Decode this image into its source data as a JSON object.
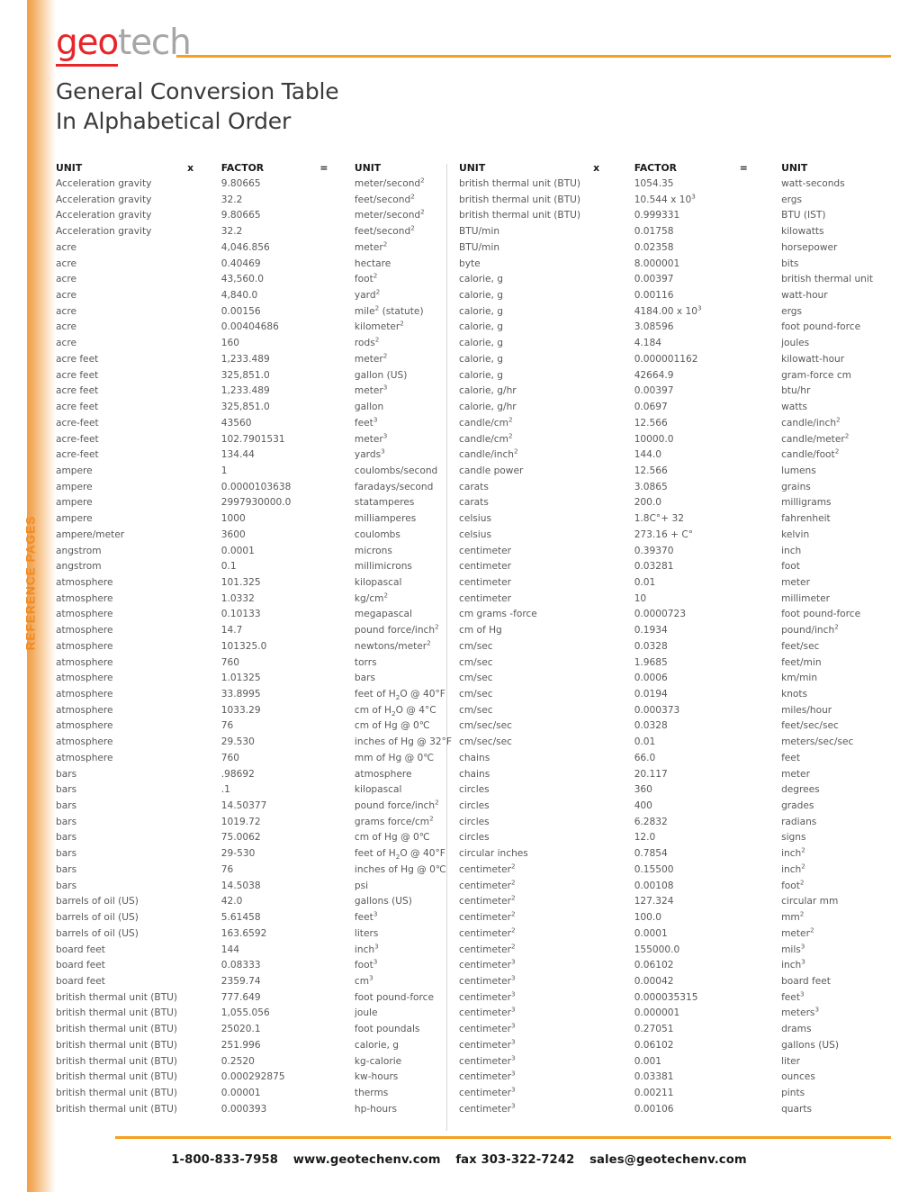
{
  "brand": {
    "logo_part1": "geo",
    "logo_part2": "tech",
    "side_tab_label": "REFERENCE PAGES",
    "accent_orange": "#f5a01f",
    "logo_red": "#e8262a",
    "logo_gray": "#a6a6a6"
  },
  "header": {
    "title_line1": "General Conversion Table",
    "title_line2": "In Alphabetical Order"
  },
  "table": {
    "headers": {
      "unit": "UNIT",
      "times": "x",
      "factor": "FACTOR",
      "equals": "=",
      "result": "UNIT"
    },
    "left_rows": [
      {
        "unit": "Acceleration gravity",
        "factor": "9.80665",
        "result": "meter/second",
        "result_sup": "2"
      },
      {
        "unit": "Acceleration gravity",
        "factor": "32.2",
        "result": "feet/second",
        "result_sup": "2"
      },
      {
        "unit": "Acceleration gravity",
        "factor": "9.80665",
        "result": "meter/second",
        "result_sup": "2"
      },
      {
        "unit": "Acceleration gravity",
        "factor": "32.2",
        "result": "feet/second",
        "result_sup": "2"
      },
      {
        "unit": "acre",
        "factor": "4,046.856",
        "result": "meter",
        "result_sup": "2"
      },
      {
        "unit": "acre",
        "factor": "0.40469",
        "result": "hectare"
      },
      {
        "unit": "acre",
        "factor": "43,560.0",
        "result": "foot",
        "result_sup": "2"
      },
      {
        "unit": "acre",
        "factor": "4,840.0",
        "result": "yard",
        "result_sup": "2"
      },
      {
        "unit": "acre",
        "factor": "0.00156",
        "result": "mile",
        "result_sup": "2",
        "result_tail": " (statute)"
      },
      {
        "unit": "acre",
        "factor": "0.00404686",
        "result": "kilometer",
        "result_sup": "2"
      },
      {
        "unit": "acre",
        "factor": "160",
        "result": "rods",
        "result_sup": "2"
      },
      {
        "unit": "acre feet",
        "factor": "1,233.489",
        "result": "meter",
        "result_sup": "2"
      },
      {
        "unit": "acre feet",
        "factor": "325,851.0",
        "result": "gallon (US)"
      },
      {
        "unit": "acre feet",
        "factor": "1,233.489",
        "result": "meter",
        "result_sup": "3"
      },
      {
        "unit": "acre feet",
        "factor": "325,851.0",
        "result": "gallon"
      },
      {
        "unit": "acre-feet",
        "factor": "43560",
        "result": "feet",
        "result_sup": "3"
      },
      {
        "unit": "acre-feet",
        "factor": "102.7901531",
        "result": "meter",
        "result_sup": "3"
      },
      {
        "unit": "acre-feet",
        "factor": "134.44",
        "result": "yards",
        "result_sup": "3"
      },
      {
        "unit": "ampere",
        "factor": "1",
        "result": "coulombs/second"
      },
      {
        "unit": "ampere",
        "factor": "0.0000103638",
        "result": "faradays/second"
      },
      {
        "unit": "ampere",
        "factor": "2997930000.0",
        "result": "statamperes"
      },
      {
        "unit": "ampere",
        "factor": "1000",
        "result": "milliamperes"
      },
      {
        "unit": "ampere/meter",
        "factor": "3600",
        "result": "coulombs"
      },
      {
        "unit": "angstrom",
        "factor": "0.0001",
        "result": "microns"
      },
      {
        "unit": "angstrom",
        "factor": "0.1",
        "result": "millimicrons"
      },
      {
        "unit": "atmosphere",
        "factor": "101.325",
        "result": "kilopascal"
      },
      {
        "unit": "atmosphere",
        "factor": "1.0332",
        "result": "kg/cm",
        "result_sup": "2"
      },
      {
        "unit": "atmosphere",
        "factor": "0.10133",
        "result": "megapascal"
      },
      {
        "unit": "atmosphere",
        "factor": "14.7",
        "result": "pound force/inch",
        "result_sup": "2"
      },
      {
        "unit": "atmosphere",
        "factor": "101325.0",
        "result": "newtons/meter",
        "result_sup": "2"
      },
      {
        "unit": "atmosphere",
        "factor": "760",
        "result": "torrs"
      },
      {
        "unit": "atmosphere",
        "factor": "1.01325",
        "result": "bars"
      },
      {
        "unit": "atmosphere",
        "factor": "33.8995",
        "result": "feet of H",
        "result_sub": "2",
        "result_tail": "O @ 40°F"
      },
      {
        "unit": "atmosphere",
        "factor": "1033.29",
        "result": "cm of H",
        "result_sub": "2",
        "result_tail": "O @ 4°C"
      },
      {
        "unit": "atmosphere",
        "factor": "76",
        "result": "cm of Hg @ 0℃"
      },
      {
        "unit": "atmosphere",
        "factor": "29.530",
        "result": "inches of Hg @ 32°F"
      },
      {
        "unit": "atmosphere",
        "factor": "760",
        "result": "mm of Hg @ 0℃"
      },
      {
        "unit": "bars",
        "factor": ".98692",
        "result": "atmosphere"
      },
      {
        "unit": "bars",
        "factor": ".1",
        "result": "kilopascal"
      },
      {
        "unit": "bars",
        "factor": "14.50377",
        "result": "pound force/inch",
        "result_sup": "2"
      },
      {
        "unit": "bars",
        "factor": "1019.72",
        "result": "grams force/cm",
        "result_sup": "2"
      },
      {
        "unit": "bars",
        "factor": "75.0062",
        "result": "cm of Hg @ 0℃"
      },
      {
        "unit": "bars",
        "factor": "29-530",
        "result": "feet of H",
        "result_sub": "2",
        "result_tail": "O @ 40°F"
      },
      {
        "unit": "bars",
        "factor": "76",
        "result": "inches of Hg @ 0℃"
      },
      {
        "unit": "bars",
        "factor": "14.5038",
        "result": "psi"
      },
      {
        "unit": "barrels of oil (US)",
        "factor": "42.0",
        "result": "gallons (US)"
      },
      {
        "unit": "barrels of oil (US)",
        "factor": "5.61458",
        "result": "feet",
        "result_sup": "3"
      },
      {
        "unit": "barrels of oil (US)",
        "factor": "163.6592",
        "result": "liters"
      },
      {
        "unit": "board feet",
        "factor": "144",
        "result": "inch",
        "result_sup": "3"
      },
      {
        "unit": "board feet",
        "factor": "0.08333",
        "result": "foot",
        "result_sup": "3"
      },
      {
        "unit": "board feet",
        "factor": "2359.74",
        "result": "cm",
        "result_sup": "3"
      },
      {
        "unit": "british thermal unit (BTU)",
        "factor": "777.649",
        "result": "foot pound-force"
      },
      {
        "unit": "british thermal unit (BTU)",
        "factor": "1,055.056",
        "result": "joule"
      },
      {
        "unit": "british thermal unit (BTU)",
        "factor": "25020.1",
        "result": "foot poundals"
      },
      {
        "unit": "british thermal unit (BTU)",
        "factor": "251.996",
        "result": "calorie, g"
      },
      {
        "unit": "british thermal unit (BTU)",
        "factor": "0.2520",
        "result": "kg-calorie"
      },
      {
        "unit": "british thermal unit (BTU)",
        "factor": "0.000292875",
        "result": "kw-hours"
      },
      {
        "unit": "british thermal unit (BTU)",
        "factor": "0.00001",
        "result": "therms"
      },
      {
        "unit": "british thermal unit (BTU)",
        "factor": "0.000393",
        "result": "hp-hours"
      }
    ],
    "right_rows": [
      {
        "unit": "british thermal unit (BTU)",
        "factor": "1054.35",
        "result": "watt-seconds"
      },
      {
        "unit": "british thermal unit (BTU)",
        "factor": "10.544 x 10",
        "factor_sup": "3",
        "result": "ergs"
      },
      {
        "unit": "british thermal unit (BTU)",
        "factor": "0.999331",
        "result": "BTU (IST)"
      },
      {
        "unit": "BTU/min",
        "factor": "0.01758",
        "result": "kilowatts"
      },
      {
        "unit": "BTU/min",
        "factor": "0.02358",
        "result": "horsepower"
      },
      {
        "unit": "byte",
        "factor": "8.000001",
        "result": "bits"
      },
      {
        "unit": "calorie, g",
        "factor": "0.00397",
        "result": "british thermal unit"
      },
      {
        "unit": "calorie, g",
        "factor": "0.00116",
        "result": "watt-hour"
      },
      {
        "unit": "calorie, g",
        "factor": "4184.00 x 10",
        "factor_sup": "3",
        "result": "ergs"
      },
      {
        "unit": "calorie, g",
        "factor": "3.08596",
        "result": "foot pound-force"
      },
      {
        "unit": "calorie, g",
        "factor": "4.184",
        "result": "joules"
      },
      {
        "unit": "calorie, g",
        "factor": "0.000001162",
        "result": "kilowatt-hour"
      },
      {
        "unit": "calorie, g",
        "factor": "42664.9",
        "result": "gram-force cm"
      },
      {
        "unit": "calorie, g/hr",
        "factor": "0.00397",
        "result": "btu/hr"
      },
      {
        "unit": "calorie, g/hr",
        "factor": "0.0697",
        "result": "watts"
      },
      {
        "unit": "candle/cm",
        "unit_sup": "2",
        "factor": "12.566",
        "result": "candle/inch",
        "result_sup": "2"
      },
      {
        "unit": "candle/cm",
        "unit_sup": "2",
        "factor": "10000.0",
        "result": "candle/meter",
        "result_sup": "2"
      },
      {
        "unit": "candle/inch",
        "unit_sup": "2",
        "factor": "144.0",
        "result": "candle/foot",
        "result_sup": "2"
      },
      {
        "unit": "candle power",
        "factor": "12.566",
        "result": "lumens"
      },
      {
        "unit": "carats",
        "factor": "3.0865",
        "result": "grains"
      },
      {
        "unit": "carats",
        "factor": "200.0",
        "result": "milligrams"
      },
      {
        "unit": "celsius",
        "factor": "1.8C°+ 32",
        "result": "fahrenheit"
      },
      {
        "unit": "celsius",
        "factor": "273.16 + C°",
        "result": "kelvin"
      },
      {
        "unit": "centimeter",
        "factor": "0.39370",
        "result": "inch"
      },
      {
        "unit": "centimeter",
        "factor": "0.03281",
        "result": "foot"
      },
      {
        "unit": "centimeter",
        "factor": "0.01",
        "result": "meter"
      },
      {
        "unit": "centimeter",
        "factor": "10",
        "result": "millimeter"
      },
      {
        "unit": "cm grams -force",
        "factor": "0.0000723",
        "result": "foot pound-force"
      },
      {
        "unit": "cm of Hg",
        "factor": "0.1934",
        "result": "pound/inch",
        "result_sup": "2"
      },
      {
        "unit": "cm/sec",
        "factor": "0.0328",
        "result": "feet/sec"
      },
      {
        "unit": "cm/sec",
        "factor": "1.9685",
        "result": "feet/min"
      },
      {
        "unit": "cm/sec",
        "factor": "0.0006",
        "result": "km/min"
      },
      {
        "unit": "cm/sec",
        "factor": "0.0194",
        "result": "knots"
      },
      {
        "unit": "cm/sec",
        "factor": "0.000373",
        "result": "miles/hour"
      },
      {
        "unit": "cm/sec/sec",
        "factor": "0.0328",
        "result": "feet/sec/sec"
      },
      {
        "unit": "cm/sec/sec",
        "factor": "0.01",
        "result": "meters/sec/sec"
      },
      {
        "unit": "chains",
        "factor": "66.0",
        "result": "feet"
      },
      {
        "unit": "chains",
        "factor": "20.117",
        "result": "meter"
      },
      {
        "unit": "circles",
        "factor": "360",
        "result": "degrees"
      },
      {
        "unit": "circles",
        "factor": "400",
        "result": "grades"
      },
      {
        "unit": "circles",
        "factor": "6.2832",
        "result": "radians"
      },
      {
        "unit": "circles",
        "factor": "12.0",
        "result": "signs"
      },
      {
        "unit": "circular inches",
        "factor": "0.7854",
        "result": "inch",
        "result_sup": "2"
      },
      {
        "unit": "centimeter",
        "unit_sup": "2",
        "factor": "0.15500",
        "result": "inch",
        "result_sup": "2"
      },
      {
        "unit": "centimeter",
        "unit_sup": "2",
        "factor": "0.00108",
        "result": "foot",
        "result_sup": "2"
      },
      {
        "unit": "centimeter",
        "unit_sup": "2",
        "factor": "127.324",
        "result": "circular mm"
      },
      {
        "unit": "centimeter",
        "unit_sup": "2",
        "factor": "100.0",
        "result": "mm",
        "result_sup": "2"
      },
      {
        "unit": "centimeter",
        "unit_sup": "2",
        "factor": "0.0001",
        "result": "meter",
        "result_sup": "2"
      },
      {
        "unit": "centimeter",
        "unit_sup": "2",
        "factor": "155000.0",
        "result": "mils",
        "result_sup": "3"
      },
      {
        "unit": "centimeter",
        "unit_sup": "3",
        "factor": "0.06102",
        "result": "inch",
        "result_sup": "3"
      },
      {
        "unit": "centimeter",
        "unit_sup": "3",
        "factor": "0.00042",
        "result": "board feet"
      },
      {
        "unit": "centimeter",
        "unit_sup": "3",
        "factor": "0.000035315",
        "result": "feet",
        "result_sup": "3"
      },
      {
        "unit": "centimeter",
        "unit_sup": "3",
        "factor": "0.000001",
        "result": "meters",
        "result_sup": "3"
      },
      {
        "unit": "centimeter",
        "unit_sup": "3",
        "factor": "0.27051",
        "result": "drams"
      },
      {
        "unit": "centimeter",
        "unit_sup": "3",
        "factor": "0.06102",
        "result": "gallons (US)"
      },
      {
        "unit": "centimeter",
        "unit_sup": "3",
        "factor": "0.001",
        "result": "liter"
      },
      {
        "unit": "centimeter",
        "unit_sup": "3",
        "factor": "0.03381",
        "result": "ounces"
      },
      {
        "unit": "centimeter",
        "unit_sup": "3",
        "factor": "0.00211",
        "result": "pints"
      },
      {
        "unit": "centimeter",
        "unit_sup": "3",
        "factor": "0.00106",
        "result": "quarts"
      }
    ]
  },
  "footer": {
    "phone": "1-800-833-7958",
    "website": "www.geotechenv.com",
    "fax": "fax 303-322-7242",
    "email": "sales@geotechenv.com"
  }
}
